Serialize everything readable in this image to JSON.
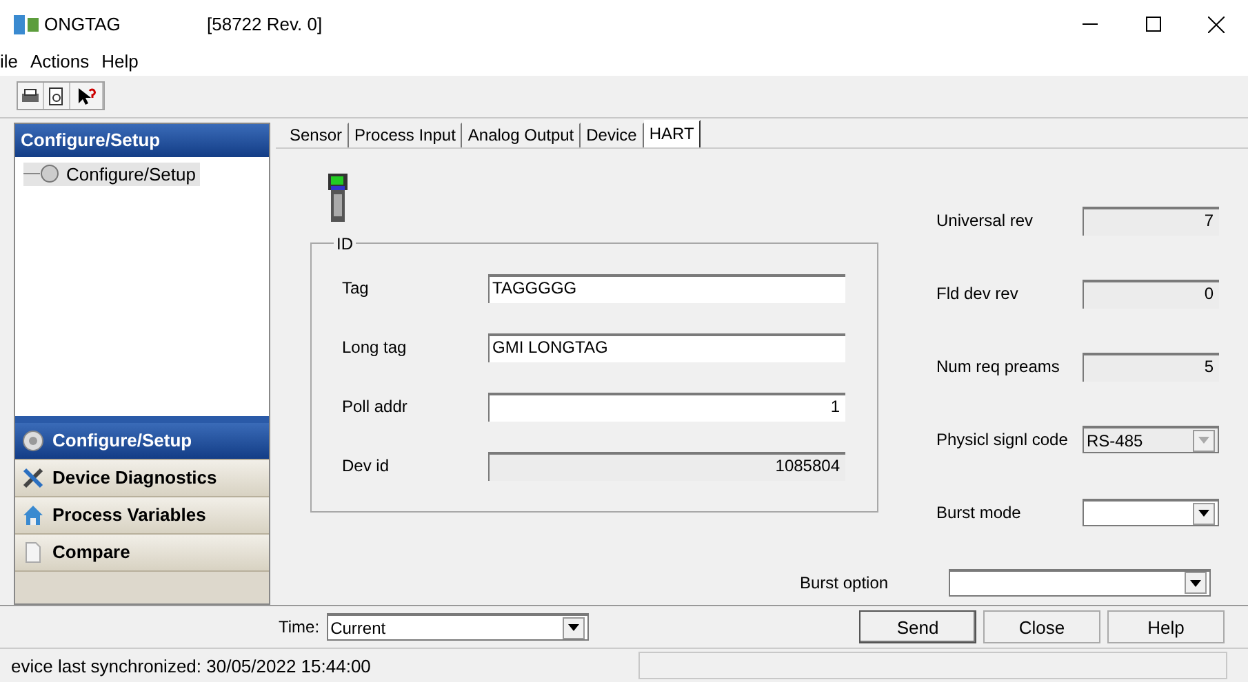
{
  "window": {
    "title": "ONGTAG",
    "subtitle": "[58722 Rev. 0]"
  },
  "menu": [
    "ile",
    "Actions",
    "Help"
  ],
  "sidebar": {
    "header": "Configure/Setup",
    "tree": [
      {
        "label": "Configure/Setup",
        "selected": true
      }
    ],
    "nav": [
      {
        "label": "Configure/Setup",
        "selected": true
      },
      {
        "label": "Device Diagnostics",
        "selected": false
      },
      {
        "label": "Process Variables",
        "selected": false
      },
      {
        "label": "Compare",
        "selected": false
      }
    ]
  },
  "tabs": [
    {
      "label": "Sensor",
      "selected": false
    },
    {
      "label": "Process Input",
      "selected": false
    },
    {
      "label": "Analog Output",
      "selected": false
    },
    {
      "label": "Device",
      "selected": false
    },
    {
      "label": "HART",
      "selected": true
    }
  ],
  "id_group": {
    "title": "ID",
    "fields": [
      {
        "label": "Tag",
        "value": "TAGGGGG",
        "kind": "text",
        "disabled": false
      },
      {
        "label": "Long tag",
        "value": "GMI LONGTAG",
        "kind": "text",
        "disabled": false
      },
      {
        "label": "Poll addr",
        "value": "1",
        "kind": "number",
        "disabled": false
      },
      {
        "label": "Dev id",
        "value": "1085804",
        "kind": "number",
        "disabled": true
      }
    ]
  },
  "right_fields": [
    {
      "label": "Universal rev",
      "value": "7",
      "kind": "number",
      "disabled": true
    },
    {
      "label": "Fld dev rev",
      "value": "0",
      "kind": "number",
      "disabled": true
    },
    {
      "label": "Num req preams",
      "value": "5",
      "kind": "number",
      "disabled": true
    },
    {
      "label": "Physicl signl code",
      "value": "RS-485",
      "kind": "dropdown",
      "disabled": true
    },
    {
      "label": "Burst mode",
      "kind": "dropdown",
      "disabled": false
    }
  ],
  "burst_option": {
    "label": "Burst option",
    "kind": "dropdown",
    "disabled": false
  },
  "time": {
    "label": "Time:",
    "value": "Current"
  },
  "buttons": [
    {
      "label": "Send",
      "default": true
    },
    {
      "label": "Close",
      "default": false
    },
    {
      "label": "Help",
      "default": false
    }
  ],
  "status_bar": {
    "text": "evice last synchronized: 30/05/2022 15:44:00"
  }
}
